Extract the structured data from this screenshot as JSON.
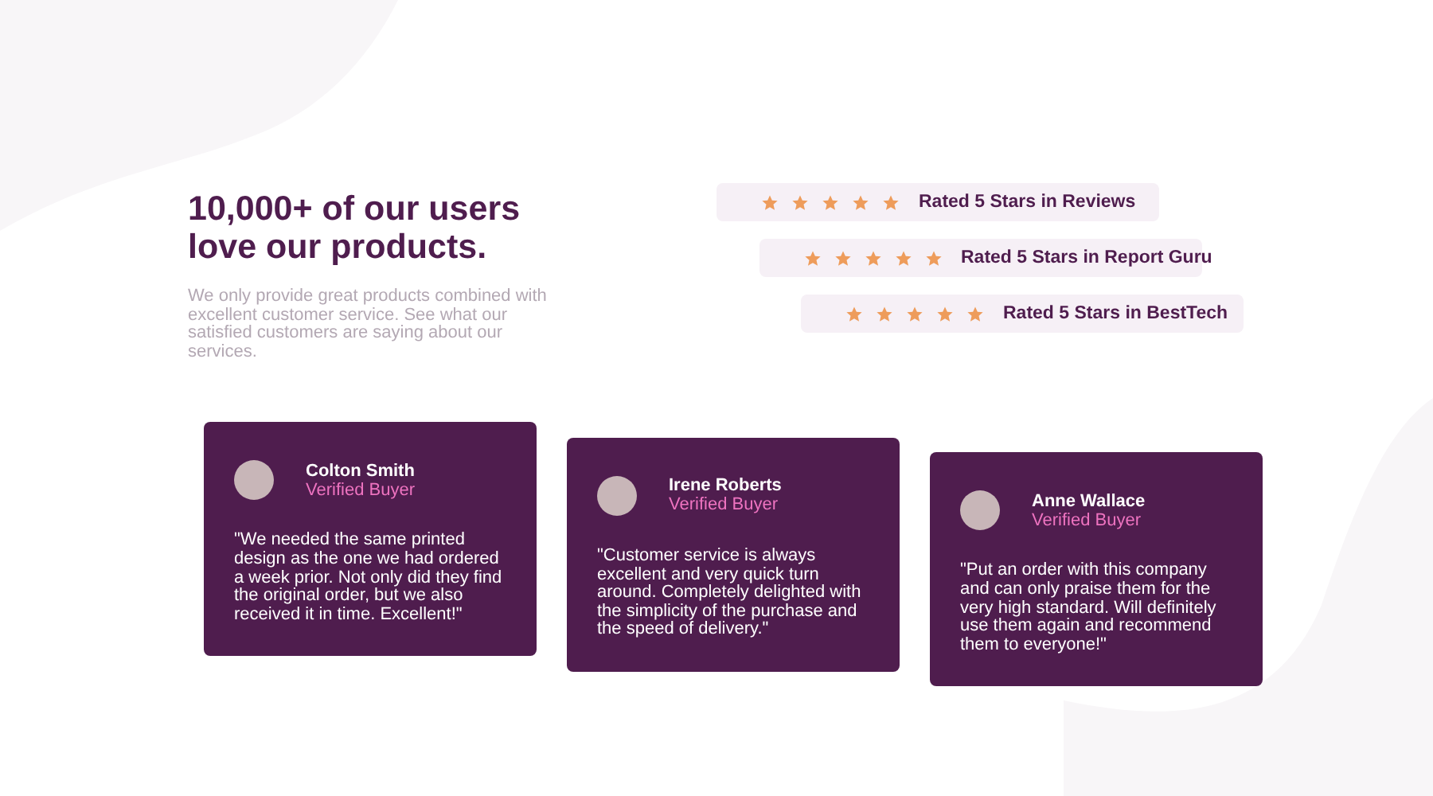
{
  "heading": "10,000+ of our users love our products.",
  "description": "We only provide great products combined with excellent customer service. See what our satisfied customers are saying about our services.",
  "ratings": [
    {
      "stars": 5,
      "label": "Rated 5 Stars in Reviews"
    },
    {
      "stars": 5,
      "label": "Rated 5 Stars in Report Guru"
    },
    {
      "stars": 5,
      "label": "Rated 5 Stars in BestTech"
    }
  ],
  "testimonials": [
    {
      "name": "Colton Smith",
      "role": "Verified Buyer",
      "quote": "\"We needed the same printed design as the one we had ordered a week prior. Not only did they find the original order, but we also received it in time. Excellent!\""
    },
    {
      "name": "Irene Roberts",
      "role": "Verified Buyer",
      "quote": "\"Customer service is always excellent and very quick turn around. Completely delighted with the simplicity of the purchase and the speed of delivery.\""
    },
    {
      "name": "Anne Wallace",
      "role": "Verified Buyer",
      "quote": "\"Put an order with this company and can only praise them for the very high standard. Will definitely use them again and recommend them to everyone!\""
    }
  ]
}
